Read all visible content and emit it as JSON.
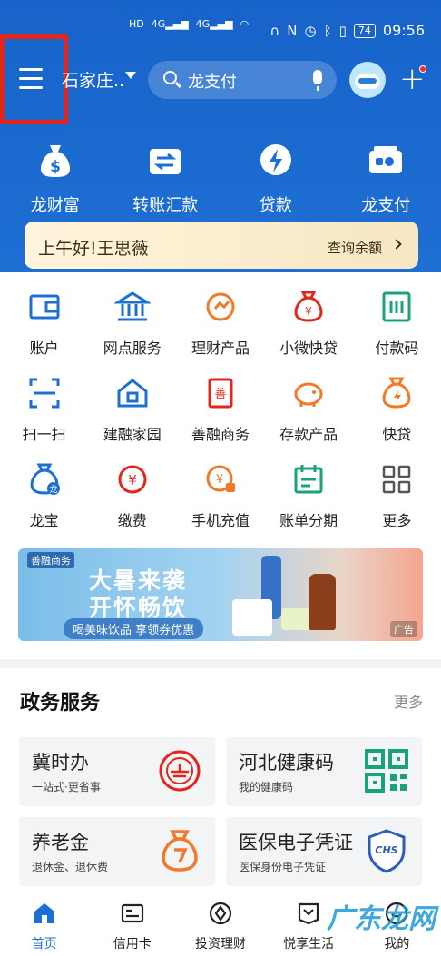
{
  "status_bar": {
    "left_labels": [
      "HD",
      "4G",
      "4G"
    ],
    "battery": "74",
    "time": "09:56"
  },
  "header": {
    "city": "石家庄..",
    "search_placeholder": "龙支付"
  },
  "quick_actions": [
    {
      "label": "龙财富",
      "icon": "money-bag-icon"
    },
    {
      "label": "转账汇款",
      "icon": "transfer-icon"
    },
    {
      "label": "贷款",
      "icon": "loan-icon"
    },
    {
      "label": "龙支付",
      "icon": "wallet-icon"
    }
  ],
  "greeting": {
    "text": "上午好!王思薇",
    "balance_link": "查询余额"
  },
  "services": [
    {
      "label": "账户",
      "icon": "account-icon"
    },
    {
      "label": "网点服务",
      "icon": "bank-icon"
    },
    {
      "label": "理财产品",
      "icon": "wealth-icon"
    },
    {
      "label": "小微快贷",
      "icon": "quick-loan-bag-icon"
    },
    {
      "label": "付款码",
      "icon": "payment-code-icon"
    },
    {
      "label": "扫一扫",
      "icon": "scan-icon"
    },
    {
      "label": "建融家园",
      "icon": "home-icon"
    },
    {
      "label": "善融商务",
      "icon": "commerce-icon"
    },
    {
      "label": "存款产品",
      "icon": "piggy-bank-icon"
    },
    {
      "label": "快贷",
      "icon": "fast-loan-icon"
    },
    {
      "label": "龙宝",
      "icon": "dragon-treasure-icon"
    },
    {
      "label": "缴费",
      "icon": "payment-icon"
    },
    {
      "label": "手机充值",
      "icon": "phone-topup-icon"
    },
    {
      "label": "账单分期",
      "icon": "calendar-icon"
    },
    {
      "label": "更多",
      "icon": "more-grid-icon"
    }
  ],
  "banner": {
    "brand": "善融商务",
    "line1": "大暑来袭",
    "line2": "开怀畅饮",
    "tagline": "喝美味饮品 享领券优惠",
    "ad_label": "广告"
  },
  "gov_services": {
    "title": "政务服务",
    "more": "更多",
    "cards": [
      {
        "title": "冀时办",
        "subtitle": "一站式·更省事",
        "icon": "seal-icon"
      },
      {
        "title": "河北健康码",
        "subtitle": "我的健康码",
        "icon": "qr-code-icon"
      },
      {
        "title": "养老金",
        "subtitle": "退休金、退休费",
        "icon": "pension-bag-icon"
      },
      {
        "title": "医保电子凭证",
        "subtitle": "医保身份电子凭证",
        "icon": "chs-shield-icon",
        "badge": "CHS"
      }
    ]
  },
  "tabs": [
    {
      "label": "首页",
      "icon": "home-tab-icon",
      "active": true
    },
    {
      "label": "信用卡",
      "icon": "credit-card-icon",
      "active": false
    },
    {
      "label": "投资理财",
      "icon": "investment-icon",
      "active": false
    },
    {
      "label": "悦享生活",
      "icon": "lifestyle-icon",
      "active": false
    },
    {
      "label": "我的",
      "icon": "profile-icon",
      "active": false
    }
  ],
  "watermark": "广东龙网",
  "colors": {
    "brand_blue": "#1e6fd4",
    "orange": "#f07a2a",
    "red": "#e3261c",
    "teal": "#18a37a"
  }
}
